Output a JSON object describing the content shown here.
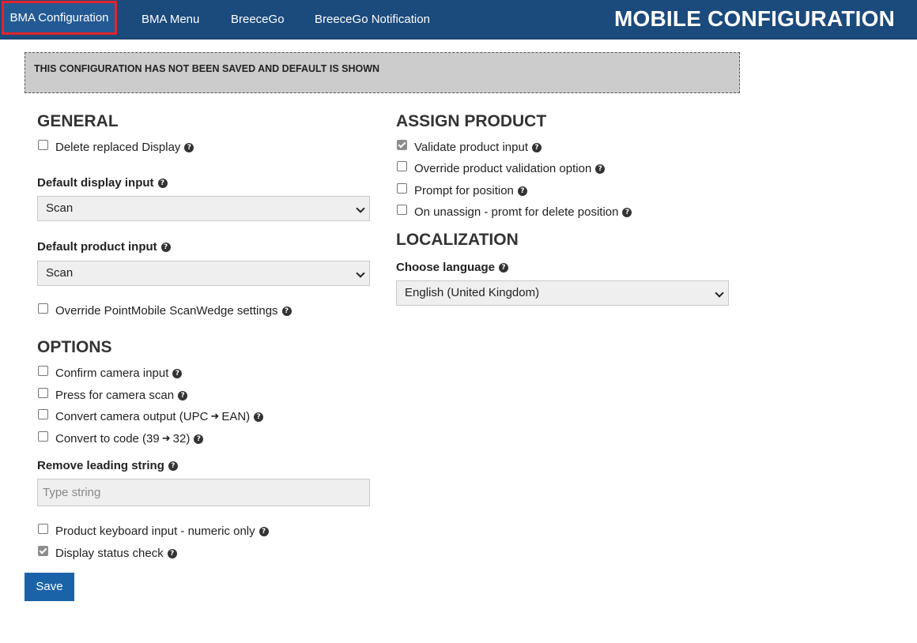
{
  "nav": {
    "items": [
      {
        "label": "BMA Configuration"
      },
      {
        "label": "BMA Menu"
      },
      {
        "label": "BreeceGo"
      },
      {
        "label": "BreeceGo Notification"
      }
    ],
    "brand": "MOBILE CONFIGURATION"
  },
  "notice": "THIS CONFIGURATION HAS NOT BEEN SAVED AND DEFAULT IS SHOWN",
  "general": {
    "heading": "GENERAL",
    "delete_replaced": {
      "label": "Delete replaced Display",
      "checked": false
    },
    "default_display_input": {
      "label": "Default display input",
      "value": "Scan"
    },
    "default_product_input": {
      "label": "Default product input",
      "value": "Scan"
    },
    "override_scanwedge": {
      "label": "Override PointMobile ScanWedge settings",
      "checked": false
    }
  },
  "options": {
    "heading": "OPTIONS",
    "confirm_camera": {
      "label": "Confirm camera input",
      "checked": false
    },
    "press_camera": {
      "label": "Press for camera scan",
      "checked": false
    },
    "convert_camera": {
      "label_a": "Convert camera output (UPC",
      "label_b": "EAN)",
      "checked": false
    },
    "convert_code": {
      "label_a": "Convert to code (39",
      "label_b": "32)",
      "checked": false
    },
    "remove_leading": {
      "label": "Remove leading string",
      "placeholder": "Type string",
      "value": ""
    },
    "numeric_only": {
      "label": "Product keyboard input - numeric only",
      "checked": false
    },
    "status_check": {
      "label": "Display status check",
      "checked": true
    }
  },
  "assign": {
    "heading": "ASSIGN PRODUCT",
    "validate": {
      "label": "Validate product input",
      "checked": true
    },
    "override_validation": {
      "label": "Override product validation option",
      "checked": false
    },
    "prompt_position": {
      "label": "Prompt for position",
      "checked": false
    },
    "unassign_delete": {
      "label": "On unassign - promt for delete position",
      "checked": false
    }
  },
  "localization": {
    "heading": "LOCALIZATION",
    "language": {
      "label": "Choose language",
      "value": "English (United Kingdom)"
    }
  },
  "save_label": "Save",
  "icons": {
    "help": "question-circle-icon",
    "arrow": "arrow-right-icon",
    "chevron": "chevron-down-icon"
  },
  "colors": {
    "nav_bg": "#1b4a7c",
    "active_outline": "#e3242b",
    "save_bg": "#1b63a8",
    "notice_bg": "#cccccc"
  }
}
